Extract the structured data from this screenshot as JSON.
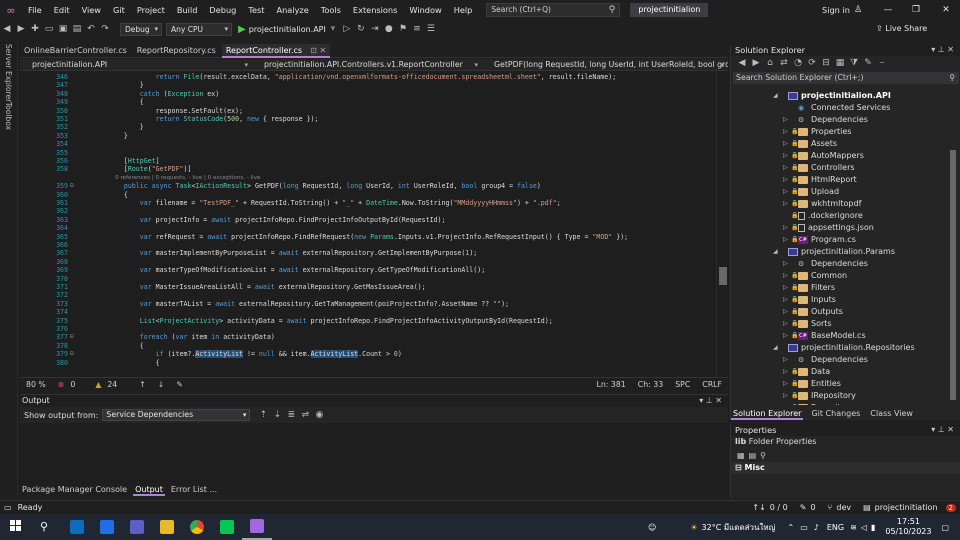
{
  "menubar": {
    "items": [
      "File",
      "Edit",
      "View",
      "Git",
      "Project",
      "Build",
      "Debug",
      "Test",
      "Analyze",
      "Tools",
      "Extensions",
      "Window",
      "Help"
    ],
    "search_placeholder": "Search (Ctrl+Q)",
    "project_name": "projectinitialion",
    "sign_in": "Sign in"
  },
  "toolbar": {
    "config": "Debug",
    "platform": "Any CPU",
    "run_target": "projectinitialion.API",
    "live_share": "Live Share"
  },
  "leftrail": {
    "server_explorer": "Server Explorer",
    "toolbox": "Toolbox"
  },
  "editor": {
    "tabs": [
      {
        "label": "OnlineBarrierController.cs",
        "active": false
      },
      {
        "label": "ReportRepository.cs",
        "active": false
      },
      {
        "label": "ReportController.cs",
        "active": true
      }
    ],
    "nav": {
      "project": "projectinitialion.API",
      "class": "projectinitialion.API.Controllers.v1.ReportController",
      "member": "GetPDF(long RequestId, long UserId, int UserRoleId, bool group"
    },
    "code_lines": [
      {
        "n": "346",
        "t": "            return File(result.excelData, \"application/vnd.openxmlformats-officedocument.spreadsheetml.sheet\", result.fileName);"
      },
      {
        "n": "347",
        "t": "        }"
      },
      {
        "n": "348",
        "t": "        catch (Exception ex)"
      },
      {
        "n": "349",
        "t": "        {"
      },
      {
        "n": "350",
        "t": "            response.SetFault(ex);"
      },
      {
        "n": "351",
        "t": "            return StatusCode(500, new { response });"
      },
      {
        "n": "352",
        "t": "        }"
      },
      {
        "n": "353",
        "t": "    }"
      },
      {
        "n": "354",
        "t": ""
      },
      {
        "n": "355",
        "t": ""
      },
      {
        "n": "356",
        "t": "    [HttpGet]"
      },
      {
        "n": "358",
        "t": "    [Route(\"GetPDF\")]"
      },
      {
        "n": "",
        "t": "    0 references | 0 requests, - live | 0 exceptions, - live"
      },
      {
        "n": "359",
        "t": "    public async Task<IActionResult> GetPDF(long RequestId, long UserId, int UserRoleId, bool group4 = false)"
      },
      {
        "n": "360",
        "t": "    {"
      },
      {
        "n": "361",
        "t": "        var filename = \"TestPDF_\" + RequestId.ToString() + \"_\" + DateTime.Now.ToString(\"MMddyyyyHHmmss\") + \".pdf\";"
      },
      {
        "n": "362",
        "t": ""
      },
      {
        "n": "363",
        "t": "        var projectInfo = await projectInfoRepo.FindProjectInfoOutputById(RequestId);"
      },
      {
        "n": "364",
        "t": ""
      },
      {
        "n": "365",
        "t": "        var refRequest = await projectInfoRepo.FindRefRequest(new Params.Inputs.v1.ProjectInfo.RefRequestInput() { Type = \"MOD\" });"
      },
      {
        "n": "366",
        "t": ""
      },
      {
        "n": "367",
        "t": "        var masterImplementByPurposeList = await externalRepository.GetImplementByPurpose(1);"
      },
      {
        "n": "368",
        "t": ""
      },
      {
        "n": "369",
        "t": "        var masterTypeOfModificationList = await externalRepository.GetTypeOfModificationAll();"
      },
      {
        "n": "370",
        "t": ""
      },
      {
        "n": "371",
        "t": "        var MasterIssueAreaListAll = await externalRepository.GetMasIssueArea();"
      },
      {
        "n": "372",
        "t": ""
      },
      {
        "n": "373",
        "t": "        var masterTAList = await externalRepository.GetTaManagement(poiProjectInfo?.AssetName ?? \"\");"
      },
      {
        "n": "374",
        "t": ""
      },
      {
        "n": "375",
        "t": "        List<ProjectActivity> activityData = await projectInfoRepo.FindProjectInfoActivityOutputById(RequestId);"
      },
      {
        "n": "376",
        "t": ""
      },
      {
        "n": "377",
        "t": "        foreach (var item in activityData)"
      },
      {
        "n": "378",
        "t": "        {"
      },
      {
        "n": "379",
        "t": "            if (item?.ActivityList != null && item.ActivityList.Count > 0)"
      },
      {
        "n": "380",
        "t": "            {"
      }
    ],
    "status": {
      "zoom": "80 %",
      "errors": "0",
      "warnings": "24",
      "ln": "Ln: 381",
      "ch": "Ch: 33",
      "spc": "SPC",
      "eol": "CRLF"
    }
  },
  "output": {
    "title": "Output",
    "show_from_label": "Show output from:",
    "source": "Service Dependencies"
  },
  "bottom_tabs": [
    {
      "label": "Package Manager Console",
      "active": false
    },
    {
      "label": "Output",
      "active": true
    },
    {
      "label": "Error List ...",
      "active": false
    }
  ],
  "solution_explorer": {
    "title": "Solution Explorer",
    "search_placeholder": "Search Solution Explorer (Ctrl+;)",
    "tree": [
      {
        "label": "projectinitialion.API",
        "level": 0,
        "kind": "proj",
        "expanded": true,
        "bold": true
      },
      {
        "label": "Connected Services",
        "level": 1,
        "kind": "svc"
      },
      {
        "label": "Dependencies",
        "level": 1,
        "kind": "dep",
        "arrow": true
      },
      {
        "label": "Properties",
        "level": 1,
        "kind": "folder",
        "arrow": true
      },
      {
        "label": "Assets",
        "level": 1,
        "kind": "folder",
        "arrow": true
      },
      {
        "label": "AutoMappers",
        "level": 1,
        "kind": "folder",
        "arrow": true
      },
      {
        "label": "Controllers",
        "level": 1,
        "kind": "folder",
        "arrow": true
      },
      {
        "label": "HtmlReport",
        "level": 1,
        "kind": "folder",
        "arrow": true
      },
      {
        "label": "Upload",
        "level": 1,
        "kind": "folder",
        "arrow": true
      },
      {
        "label": "wkhtmltopdf",
        "level": 1,
        "kind": "folder",
        "arrow": true
      },
      {
        "label": ".dockerignore",
        "level": 1,
        "kind": "file"
      },
      {
        "label": "appsettings.json",
        "level": 1,
        "kind": "file",
        "arrow": true
      },
      {
        "label": "Program.cs",
        "level": 1,
        "kind": "cs",
        "arrow": true
      },
      {
        "label": "projectinitialion.Params",
        "level": 0,
        "kind": "proj",
        "expanded": true
      },
      {
        "label": "Dependencies",
        "level": 1,
        "kind": "dep",
        "arrow": true
      },
      {
        "label": "Common",
        "level": 1,
        "kind": "folder",
        "arrow": true
      },
      {
        "label": "Filters",
        "level": 1,
        "kind": "folder",
        "arrow": true
      },
      {
        "label": "Inputs",
        "level": 1,
        "kind": "folder",
        "arrow": true
      },
      {
        "label": "Outputs",
        "level": 1,
        "kind": "folder",
        "arrow": true
      },
      {
        "label": "Sorts",
        "level": 1,
        "kind": "folder",
        "arrow": true
      },
      {
        "label": "BaseModel.cs",
        "level": 1,
        "kind": "cs",
        "arrow": true
      },
      {
        "label": "projectinitialion.Repositories",
        "level": 0,
        "kind": "proj",
        "expanded": true
      },
      {
        "label": "Dependencies",
        "level": 1,
        "kind": "dep",
        "arrow": true
      },
      {
        "label": "Data",
        "level": 1,
        "kind": "folder",
        "arrow": true
      },
      {
        "label": "Entities",
        "level": 1,
        "kind": "folder",
        "arrow": true
      },
      {
        "label": "IRepository",
        "level": 1,
        "kind": "folder",
        "arrow": true
      },
      {
        "label": "Repository",
        "level": 1,
        "kind": "folder",
        "arrow": true
      }
    ],
    "tabs": [
      "Solution Explorer",
      "Git Changes",
      "Class View"
    ]
  },
  "properties": {
    "title": "Properties",
    "subject_prefix": "lib",
    "subject": "Folder Properties",
    "section": "Misc"
  },
  "statusbar": {
    "ready": "Ready",
    "line_counter": "0 / 0",
    "pencil_count": "0",
    "branch": "dev",
    "repo": "projectinitiation",
    "notif": "2"
  },
  "taskbar": {
    "weather": "32°C มีแดดส่วนใหญ่",
    "lang": "ENG",
    "time": "17:51",
    "date": "05/10/2023",
    "apps": [
      {
        "name": "start",
        "color": "#ffffff"
      },
      {
        "name": "search",
        "color": "#ffffff"
      },
      {
        "name": "outlook",
        "color": "#0f6cbd"
      },
      {
        "name": "maps",
        "color": "#1f6feb"
      },
      {
        "name": "teams",
        "color": "#5b5fc7"
      },
      {
        "name": "explorer",
        "color": "#e8b928"
      },
      {
        "name": "chrome",
        "color": "#34a853"
      },
      {
        "name": "line",
        "color": "#06c755"
      },
      {
        "name": "visual-studio",
        "color": "#a168e2"
      }
    ]
  }
}
